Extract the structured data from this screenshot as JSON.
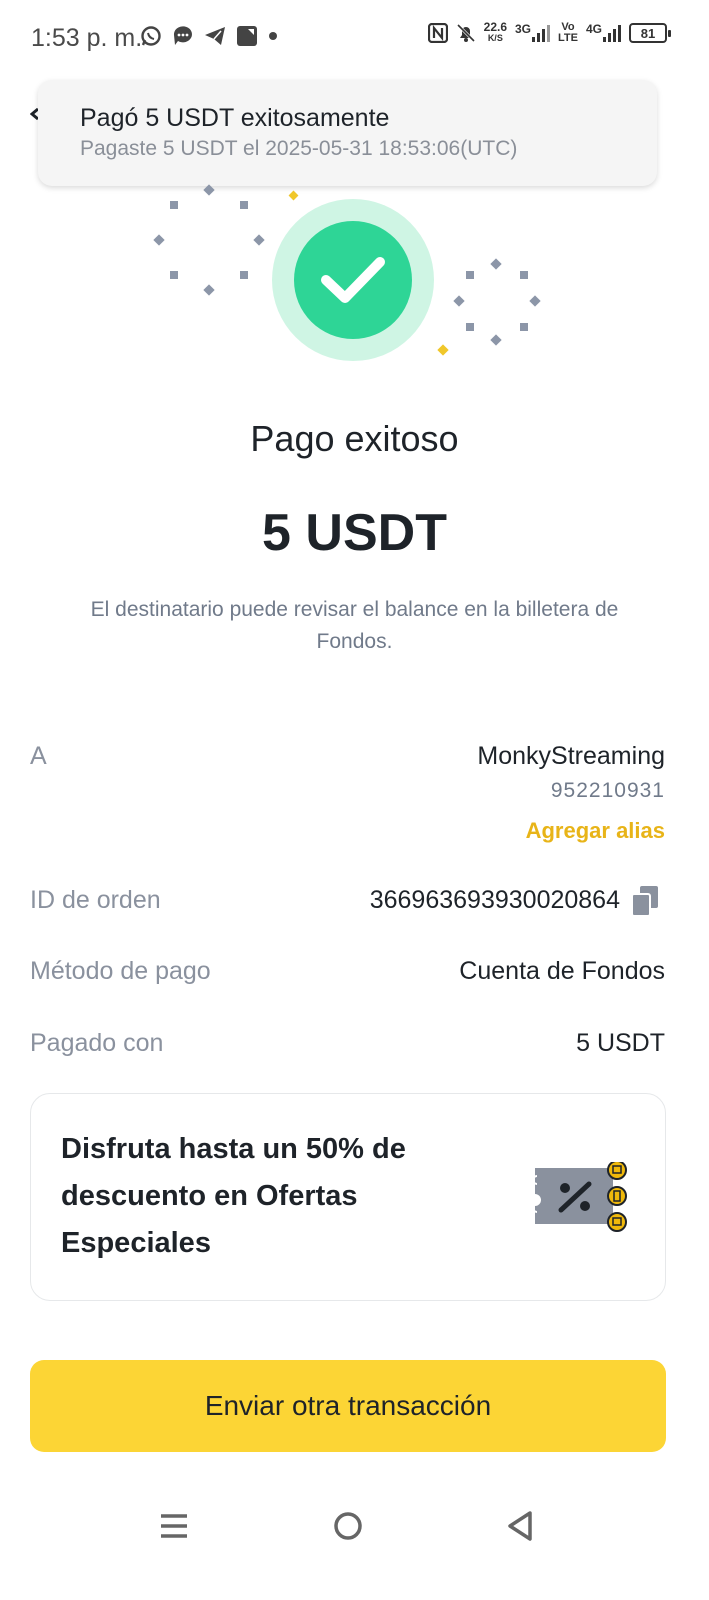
{
  "status_bar": {
    "time": "1:53 p. m.",
    "net_speed_value": "22.6",
    "net_speed_unit": "K/S",
    "network_3g": "3G",
    "volte_top": "Vo",
    "volte_bottom": "LTE",
    "network_4g": "4G",
    "battery": "81"
  },
  "notification": {
    "title": "Pagó 5 USDT exitosamente",
    "subtitle": "Pagaste 5 USDT el 2025-05-31 18:53:06(UTC)"
  },
  "result": {
    "title": "Pago exitoso",
    "amount": "5 USDT",
    "description": "El destinatario puede revisar el balance en la billetera de Fondos."
  },
  "details": {
    "recipient_label": "A",
    "recipient_name": "MonkyStreaming",
    "recipient_id": "952210931",
    "add_alias": "Agregar alias",
    "order_id_label": "ID de orden",
    "order_id": "366963693930020864",
    "payment_method_label": "Método de pago",
    "payment_method": "Cuenta de Fondos",
    "paid_with_label": "Pagado con",
    "paid_with": "5 USDT"
  },
  "promo": {
    "text": "Disfruta hasta un 50% de descuento en Ofertas Especiales",
    "icon": "discount-coupon-icon"
  },
  "cta": {
    "label": "Enviar otra transacción"
  },
  "colors": {
    "success": "#2ed596",
    "success_ring": "#cff5e4",
    "accent_yellow": "#fcd535",
    "link_yellow": "#e8b418",
    "text_primary": "#1e2329",
    "text_secondary": "#8a919e"
  }
}
